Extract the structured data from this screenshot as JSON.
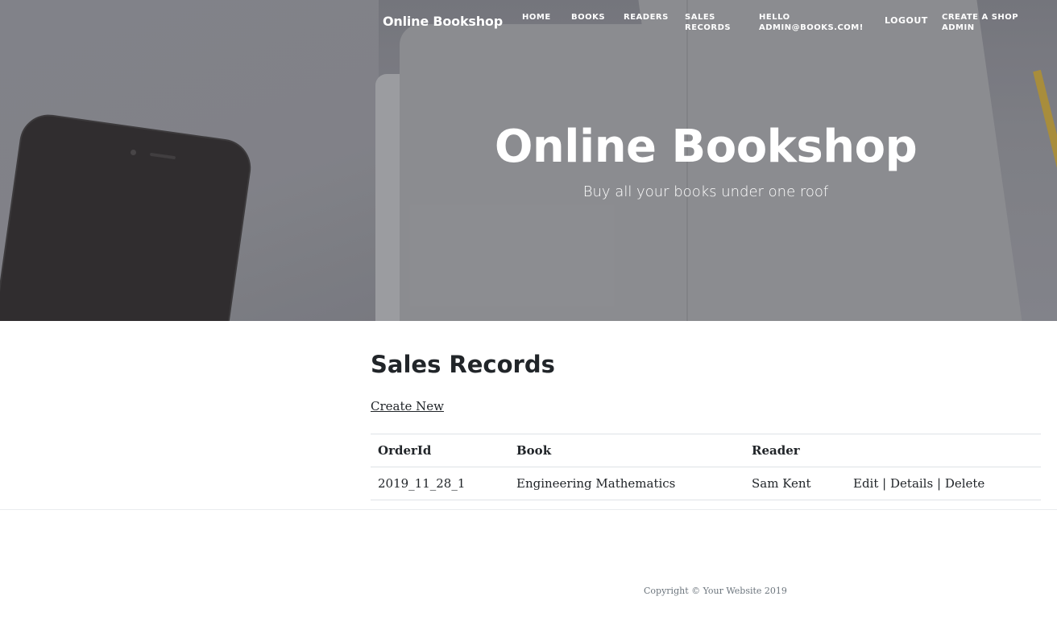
{
  "header": {
    "brand": "Online Bookshop",
    "nav": {
      "home": "HOME",
      "books": "BOOKS",
      "readers": "READERS",
      "sales_records": "SALES RECORDS",
      "hello": "HELLO ADMIN@BOOKS.COM!",
      "logout": "LOGOUT",
      "create_shop_admin": "CREATE A SHOP ADMIN"
    }
  },
  "hero": {
    "title": "Online Bookshop",
    "subtitle": "Buy all your books under one roof"
  },
  "main": {
    "page_title": "Sales Records",
    "create_new": "Create New",
    "table": {
      "headers": [
        "OrderId",
        "Book",
        "Reader"
      ],
      "rows": [
        {
          "order_id": "2019_11_28_1",
          "book": "Engineering Mathematics",
          "reader": "Sam Kent",
          "actions": {
            "edit": "Edit",
            "details": "Details",
            "delete": "Delete",
            "separator": "|"
          }
        }
      ]
    }
  },
  "footer": {
    "copyright": "Copyright © Your Website 2019"
  },
  "colors": {
    "text": "#212529",
    "hero_overlay": "#85868c",
    "border": "#dee2e6",
    "muted": "#6c757d"
  }
}
